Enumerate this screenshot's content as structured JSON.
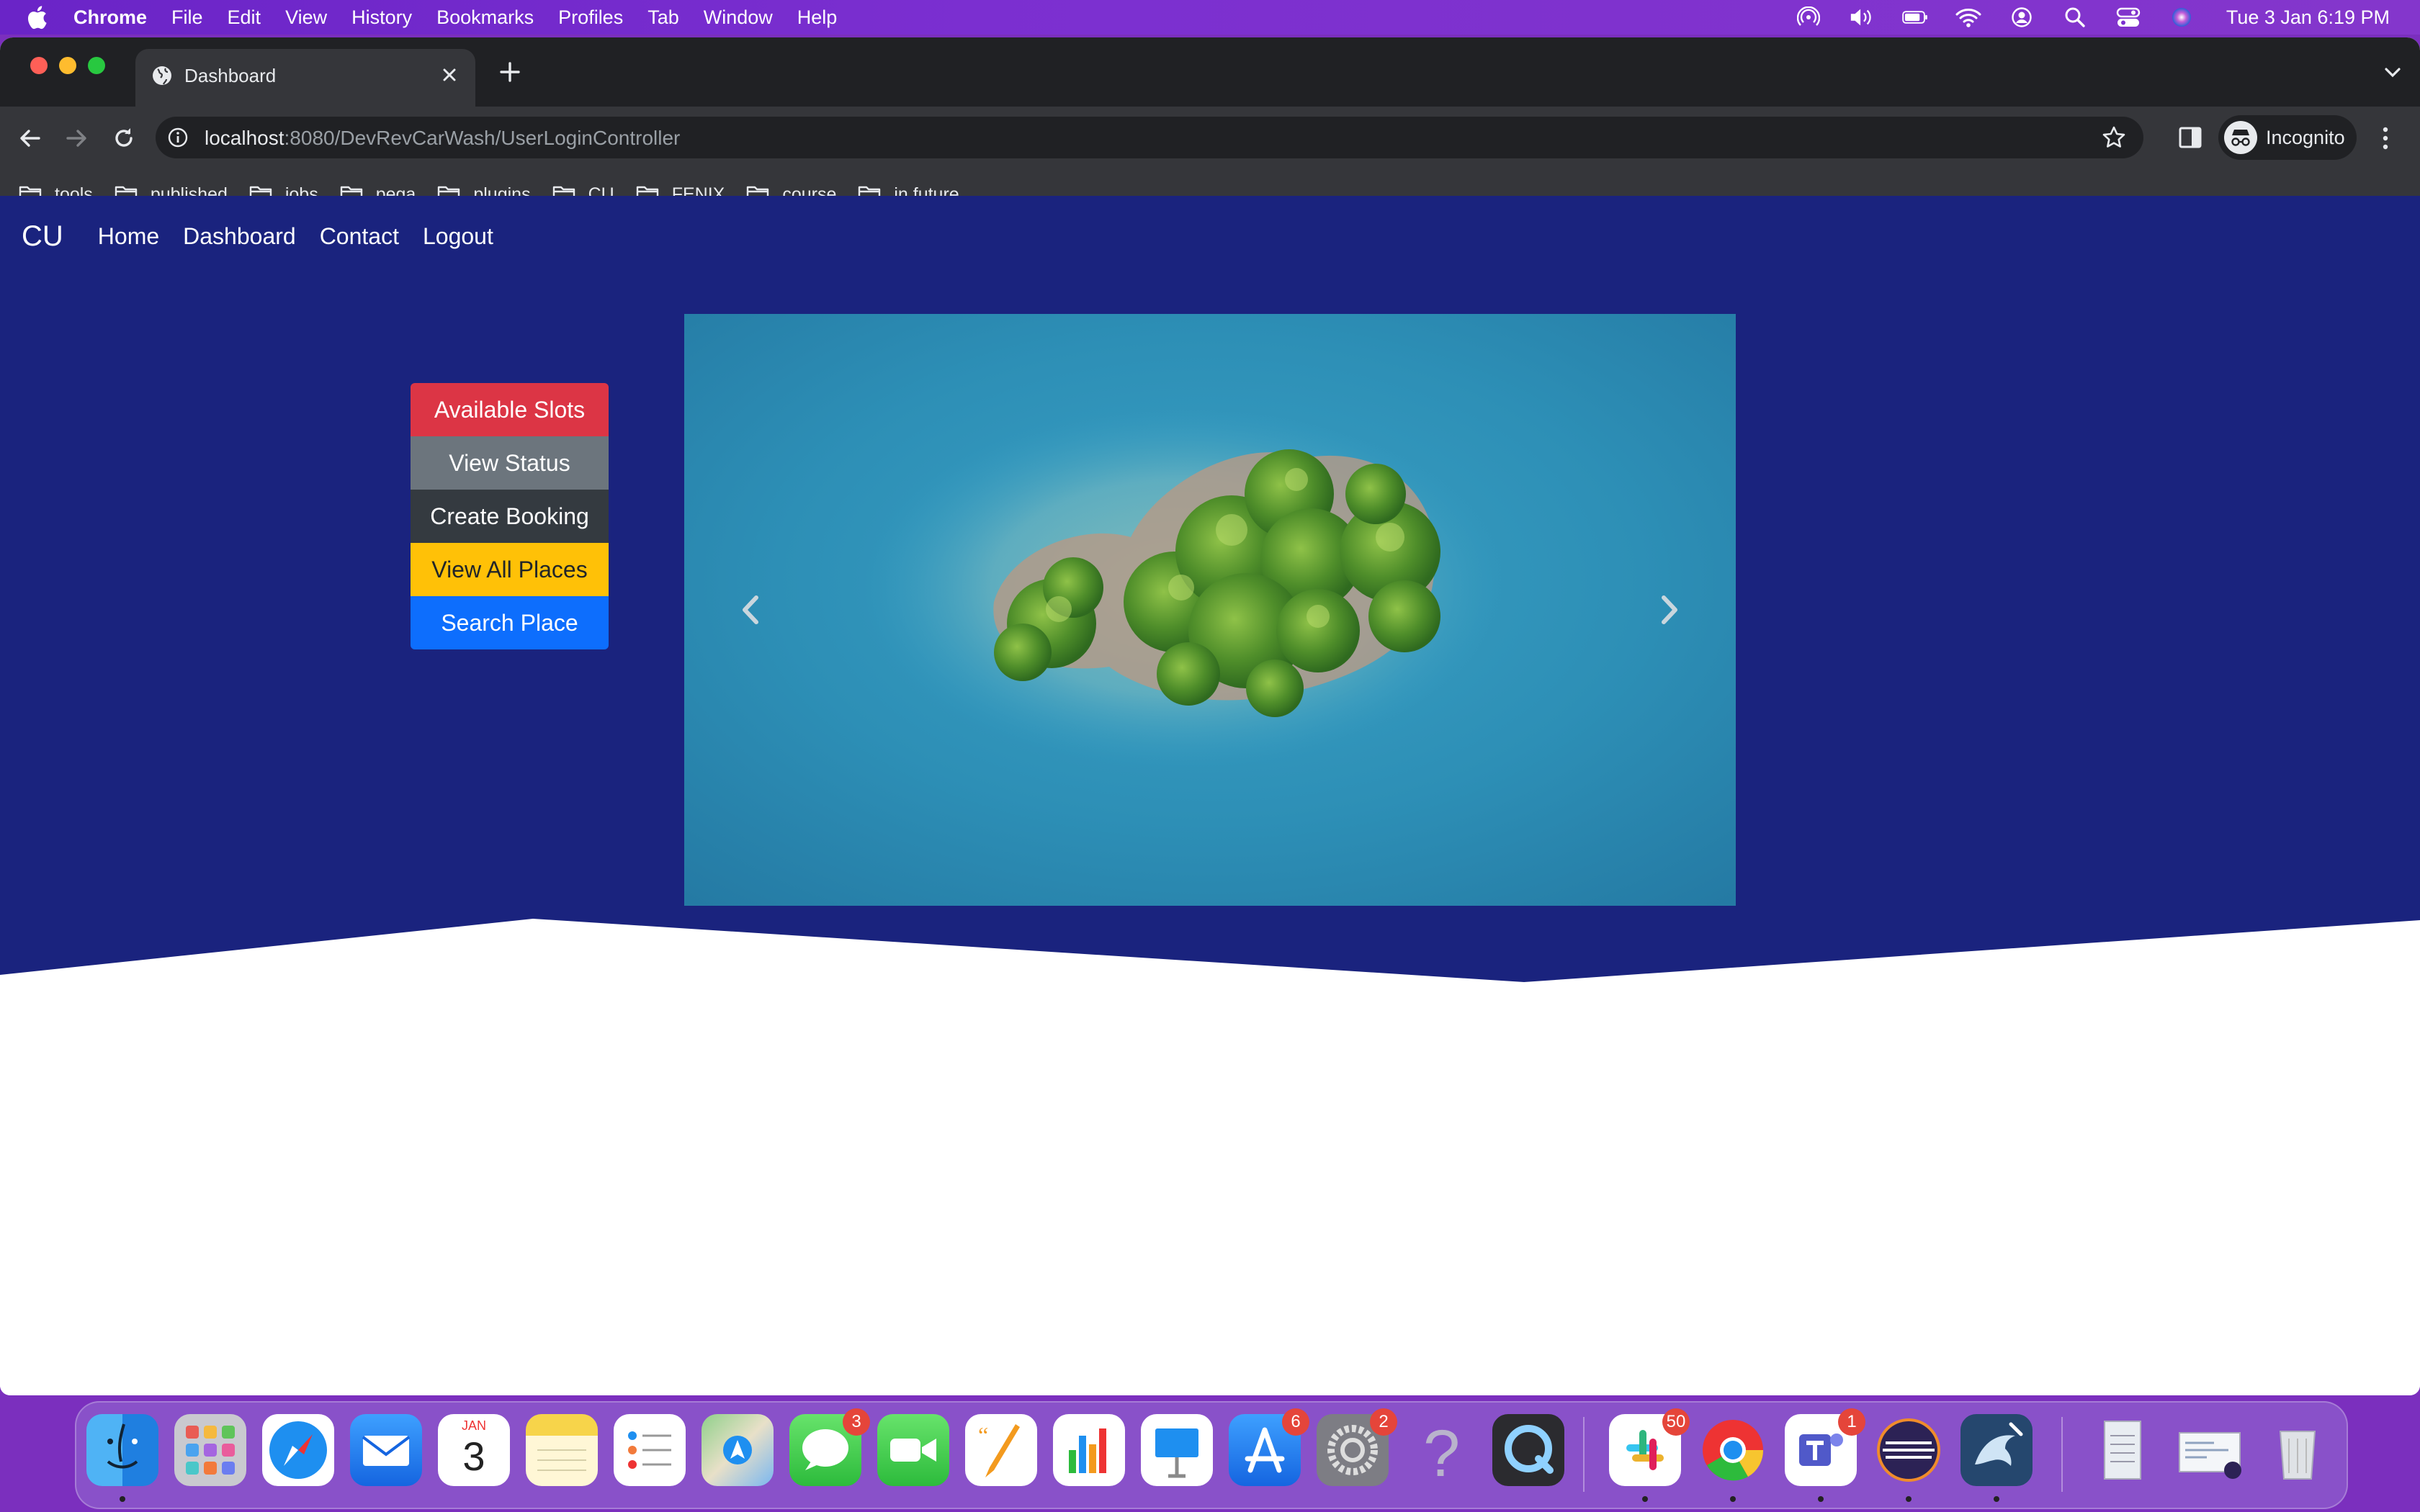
{
  "menubar": {
    "app": "Chrome",
    "items": [
      "File",
      "Edit",
      "View",
      "History",
      "Bookmarks",
      "Profiles",
      "Tab",
      "Window",
      "Help"
    ],
    "clock": "Tue 3 Jan  6:19 PM"
  },
  "browser": {
    "tab_title": "Dashboard",
    "url_host": "localhost",
    "url_rest": ":8080/DevRevCarWash/UserLoginController",
    "profile_label": "Incognito",
    "bookmarks": [
      "tools",
      "published",
      "jobs",
      "pega",
      "plugins",
      "CU",
      "FENIX",
      "course",
      "in future"
    ]
  },
  "page": {
    "brand": "CU",
    "nav": [
      "Home",
      "Dashboard",
      "Contact",
      "Logout"
    ],
    "buttons": [
      "Available Slots",
      "View Status",
      "Create Booking",
      "View All Places",
      "Search Place"
    ],
    "colors": {
      "hero_bg": "#1a237e",
      "btn_red": "#dc3545",
      "btn_grey": "#6c757d",
      "btn_dark": "#343a40",
      "btn_yellow": "#ffc107",
      "btn_blue": "#0d6efd"
    }
  },
  "dock": {
    "apps": [
      {
        "name": "finder-icon",
        "badge": ""
      },
      {
        "name": "launchpad-icon",
        "badge": ""
      },
      {
        "name": "safari-icon",
        "badge": ""
      },
      {
        "name": "mail-icon",
        "badge": ""
      },
      {
        "name": "calendar-icon",
        "badge": ""
      },
      {
        "name": "notes-icon",
        "badge": ""
      },
      {
        "name": "reminders-icon",
        "badge": ""
      },
      {
        "name": "maps-icon",
        "badge": ""
      },
      {
        "name": "messages-icon",
        "badge": "3"
      },
      {
        "name": "facetime-icon",
        "badge": ""
      },
      {
        "name": "pages-icon",
        "badge": ""
      },
      {
        "name": "numbers-icon",
        "badge": ""
      },
      {
        "name": "keynote-icon",
        "badge": ""
      },
      {
        "name": "app-store-icon",
        "badge": "6"
      },
      {
        "name": "system-settings-icon",
        "badge": "2"
      },
      {
        "name": "help-icon",
        "badge": ""
      },
      {
        "name": "quicktime-icon",
        "badge": ""
      },
      {
        "name": "slack-icon",
        "badge": "50"
      },
      {
        "name": "chrome-icon",
        "badge": ""
      },
      {
        "name": "teams-icon",
        "badge": "1"
      },
      {
        "name": "eclipse-icon",
        "badge": ""
      },
      {
        "name": "mysql-workbench-icon",
        "badge": ""
      },
      {
        "name": "documents-icon",
        "badge": ""
      },
      {
        "name": "preview-window-icon",
        "badge": ""
      },
      {
        "name": "trash-icon",
        "badge": ""
      }
    ],
    "calendar_month": "JAN",
    "calendar_day": "3"
  }
}
